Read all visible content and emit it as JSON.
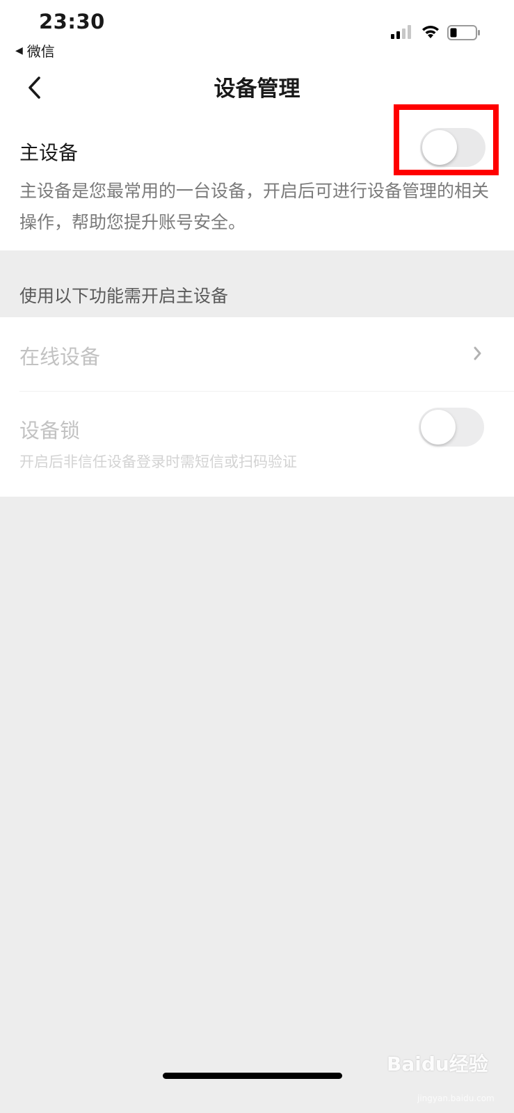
{
  "status_bar": {
    "time": "23:30",
    "back_app_label": "微信",
    "back_app_arrow": "◀"
  },
  "nav": {
    "title": "设备管理"
  },
  "primary_device": {
    "title": "主设备",
    "description": "主设备是您最常用的一台设备，开启后可进行设备管理的相关操作，帮助您提升账号安全。",
    "toggle_on": false
  },
  "features_section": {
    "header": "使用以下功能需开启主设备",
    "online_devices_label": "在线设备",
    "device_lock_label": "设备锁",
    "device_lock_desc": "开启后非信任设备登录时需短信或扫码验证",
    "device_lock_on": false
  },
  "watermark": {
    "brand": "Baidu经验",
    "url": "jingyan.baidu.com"
  },
  "colors": {
    "highlight": "#ff0000",
    "background": "#ededed"
  }
}
